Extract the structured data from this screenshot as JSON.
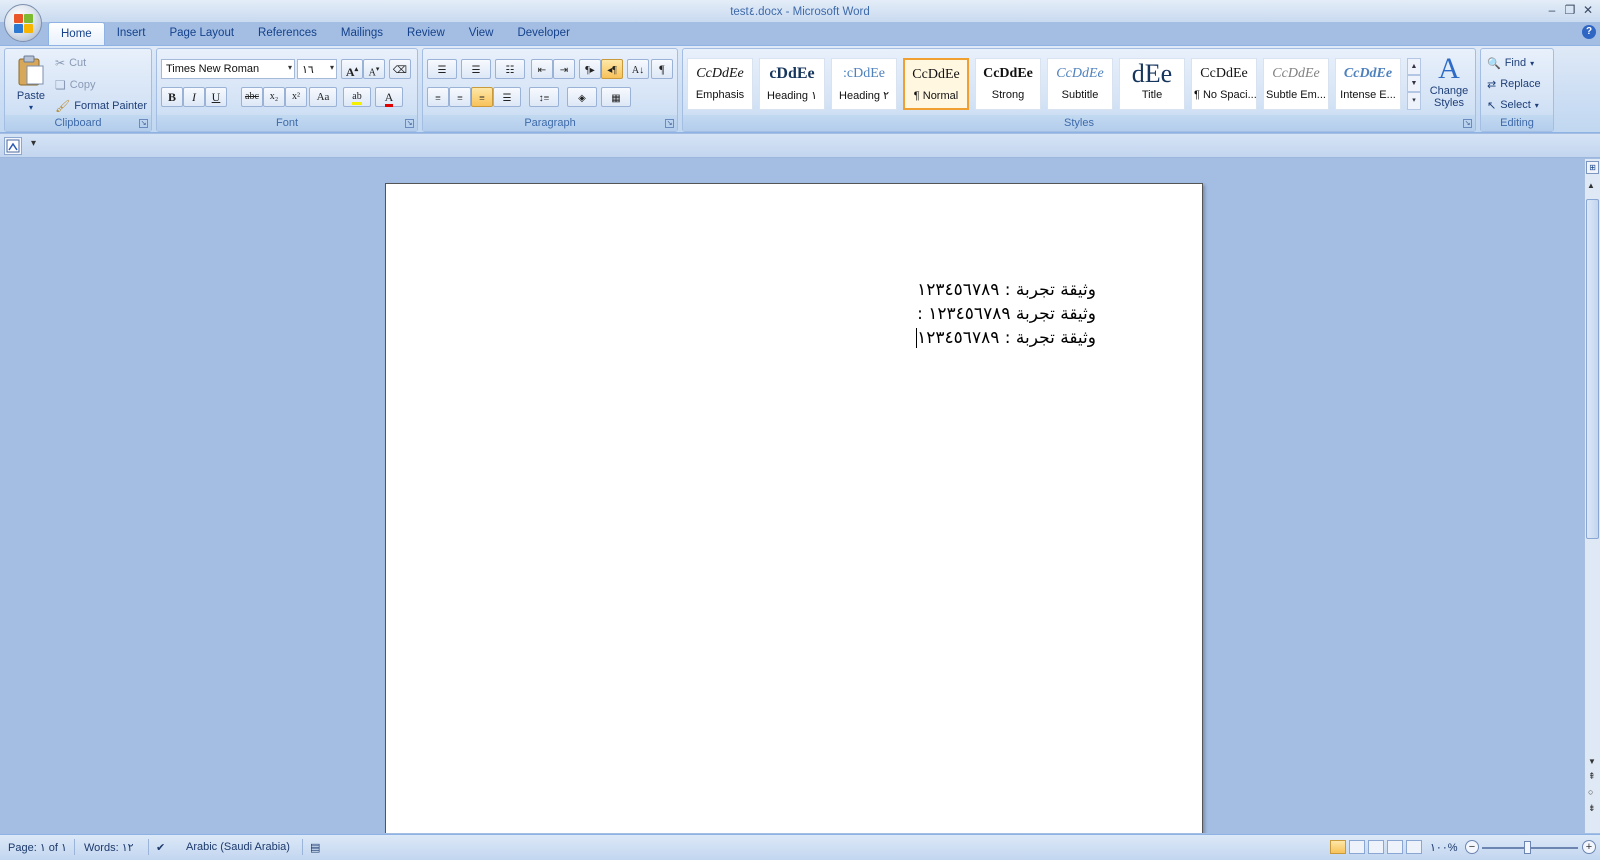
{
  "window": {
    "title": "test٤.docx - Microsoft Word"
  },
  "tabs": [
    "Home",
    "Insert",
    "Page Layout",
    "References",
    "Mailings",
    "Review",
    "View",
    "Developer"
  ],
  "clipboard": {
    "label": "Clipboard",
    "paste": "Paste",
    "cut": "Cut",
    "copy": "Copy",
    "format_painter": "Format Painter"
  },
  "font": {
    "label": "Font",
    "family": "Times New Roman",
    "size": "١٦",
    "bold": "B",
    "italic": "I",
    "underline": "U",
    "strike": "abc",
    "subscript": "x₂",
    "superscript": "x²",
    "change_case": "Aa",
    "grow": "A",
    "shrink": "A",
    "highlight": "ab",
    "color": "A"
  },
  "paragraph": {
    "label": "Paragraph",
    "pilcrow": "¶"
  },
  "styles": {
    "label": "Styles",
    "items": [
      {
        "sample": "CcDdEe",
        "name": "Emphasis"
      },
      {
        "sample": "cDdEe",
        "name": "Heading ١"
      },
      {
        "sample": ":cDdEe",
        "name": "Heading ٢"
      },
      {
        "sample": "CcDdEe",
        "name": "¶ Normal"
      },
      {
        "sample": "CcDdEe",
        "name": "Strong"
      },
      {
        "sample": "CcDdEe",
        "name": "Subtitle"
      },
      {
        "sample": "dEe",
        "name": "Title"
      },
      {
        "sample": "CcDdEe",
        "name": "¶ No Spaci..."
      },
      {
        "sample": "CcDdEe",
        "name": "Subtle Em..."
      },
      {
        "sample": "CcDdEe",
        "name": "Intense E..."
      }
    ],
    "selected_index": 3,
    "change_styles": "Change Styles"
  },
  "editing": {
    "label": "Editing",
    "find": "Find",
    "replace": "Replace",
    "select": "Select"
  },
  "document": {
    "lines": [
      "وثيقة تجربة : ١٢٣٤٥٦٧٨٩",
      "وثيقة تجربة ١٢٣٤٥٦٧٨٩ :",
      "وثيقة تجربة : ١٢٣٤٥٦٧٨٩"
    ]
  },
  "status": {
    "page": "Page: ١ of ١",
    "words": "Words: ١٢",
    "language": "Arabic (Saudi Arabia)",
    "zoom": "١٠٠%"
  },
  "colors": {
    "accent": "#15428b",
    "workspace": "#a3bde3",
    "selected_style_border": "#f0a030"
  },
  "icons": [
    "office-button-icon",
    "help-icon",
    "paste-icon",
    "cut-icon",
    "copy-icon",
    "format-painter-icon",
    "change-styles-icon",
    "find-icon",
    "replace-icon",
    "select-icon",
    "spelling-icon",
    "macro-icon"
  ]
}
